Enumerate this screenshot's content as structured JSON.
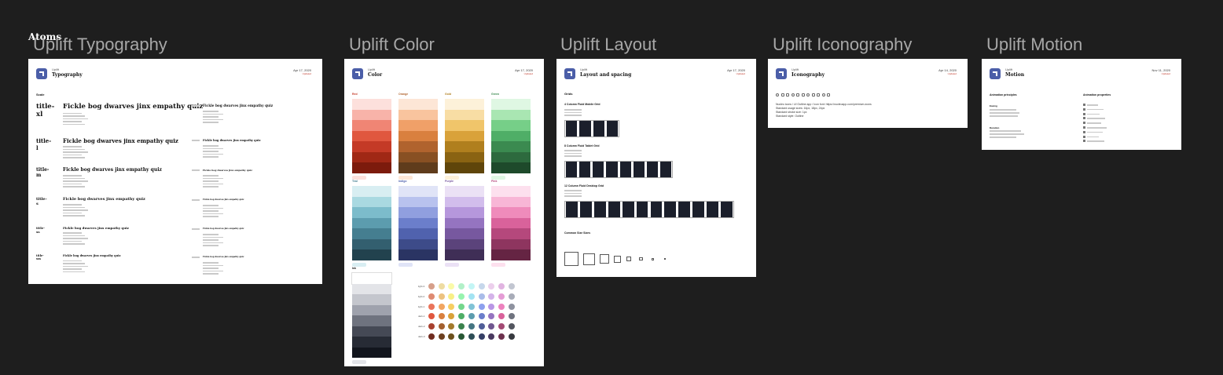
{
  "page_label": "Atoms",
  "frames": {
    "typography": {
      "title": "Uplift Typography",
      "brand": "Uplift",
      "header": "Typography",
      "date": "Apr 17, 2020",
      "status": "Updated",
      "section": "Scale",
      "rows": [
        {
          "name": "title-xl",
          "sample": "Fickle bog dwarves jinx empathy quiz"
        },
        {
          "name": "title-l",
          "sample": "Fickle bog dwarves jinx empathy quiz"
        },
        {
          "name": "title-m",
          "sample": "Fickle bog dwarves jinx empathy quiz"
        },
        {
          "name": "title-s",
          "sample": "Fickle bog dwarves jinx empathy quiz"
        },
        {
          "name": "title-xs",
          "sample": "Fickle bog dwarves jinx empathy quiz"
        },
        {
          "name": "title-xxs",
          "sample": "Fickle bog dwarves jinx empathy quiz"
        }
      ]
    },
    "color": {
      "title": "Uplift Color",
      "brand": "Uplift",
      "header": "Color",
      "date": "Apr 17, 2020",
      "status": "Updated",
      "groups": [
        {
          "name": "Red",
          "swatches": [
            "#fde0dc",
            "#f8b3a9",
            "#f08574",
            "#e0573f",
            "#c43a26",
            "#a02815",
            "#7c1b0c"
          ],
          "foot_bg": "#fde0dc"
        },
        {
          "name": "Orange",
          "swatches": [
            "#fde6d6",
            "#f9c49e",
            "#f0a068",
            "#d9803f",
            "#b0632e",
            "#885023",
            "#5f3c1c"
          ],
          "foot_bg": "#fde6d6"
        },
        {
          "name": "Gold",
          "swatches": [
            "#fdf1d9",
            "#f8dda4",
            "#f0c56a",
            "#d9a23a",
            "#b07f1e",
            "#8a6312",
            "#5f450a"
          ],
          "foot_bg": "#fdf1d9"
        },
        {
          "name": "Green",
          "swatches": [
            "#dff7e3",
            "#a9e6b2",
            "#76cf88",
            "#4fae67",
            "#3b8a50",
            "#2d6a3e",
            "#1e4a2b"
          ],
          "foot_bg": "#dff7e3"
        },
        {
          "name": "Teal",
          "swatches": [
            "#d8eef2",
            "#a9d9e1",
            "#7cbccb",
            "#5c9cae",
            "#457e90",
            "#335f6f",
            "#22424e"
          ],
          "foot_bg": "#d8eef2"
        },
        {
          "name": "Indigo",
          "swatches": [
            "#e0e4f7",
            "#b8c2ee",
            "#909fdf",
            "#6b7ecb",
            "#5062ae",
            "#3d4b89",
            "#2a3463"
          ],
          "foot_bg": "#e0e4f7"
        },
        {
          "name": "Purple",
          "swatches": [
            "#ebe1f5",
            "#d2bdec",
            "#b697dc",
            "#9574c0",
            "#77589f",
            "#5b437b",
            "#3f2e56"
          ],
          "foot_bg": "#ebe1f5"
        },
        {
          "name": "Pink",
          "swatches": [
            "#fde0ee",
            "#f8b6d6",
            "#ef8bbb",
            "#d9629b",
            "#b5487c",
            "#8e355f",
            "#652443"
          ],
          "foot_bg": "#fde0ee"
        }
      ],
      "ink": {
        "name": "Ink",
        "swatches": [
          "#ffffff",
          "#e3e4e8",
          "#c4c6cd",
          "#9fa2ad",
          "#6f737f",
          "#454955",
          "#272b35",
          "#12151d"
        ]
      },
      "dot_rows": [
        "light-3",
        "light-2",
        "light-1",
        "dark-1",
        "dark-2",
        "dark-3"
      ],
      "dot_cols": [
        "#e0573f",
        "#d9803f",
        "#d9a23a",
        "#4fae67",
        "#5c9cae",
        "#6b7ecb",
        "#9574c0",
        "#d9629b",
        "#6f737f"
      ]
    },
    "layout": {
      "title": "Uplift Layout",
      "brand": "Uplift",
      "header": "Layout and spacing",
      "date": "Apr 17, 2020",
      "status": "Updated",
      "section": "Grids",
      "grid1": "4 Column Fluid Mobile Grid",
      "grid2": "8 Column Fluid Tablet Grid",
      "grid3": "12 Column Fluid Desktop Grid",
      "section2": "Common Size Sizes",
      "grid_cols": [
        4,
        8,
        12
      ],
      "sizes": [
        6,
        5,
        4,
        3,
        2,
        1.5,
        1,
        0.7
      ]
    },
    "iconography": {
      "title": "Uplift Iconography",
      "brand": "Uplift",
      "header": "Iconography",
      "date": "Apr 14, 2020",
      "status": "Updated",
      "line1": "Nucleo icons / UI Outline app / Icon font: https://nucleoapp.com/premium-icons",
      "line2": "Standard usage sizes: 16px, 18px, 24px",
      "line3": "Standard stroke size: 1px",
      "line4": "Standard style: Outline"
    },
    "motion": {
      "title": "Uplift Motion",
      "brand": "Uplift",
      "header": "Motion",
      "date": "Nov 11, 2020",
      "status": "Updated",
      "col1": "Animation principles",
      "col2": "Animation properties",
      "sub1": "Easing",
      "sub2": "Duration"
    }
  }
}
